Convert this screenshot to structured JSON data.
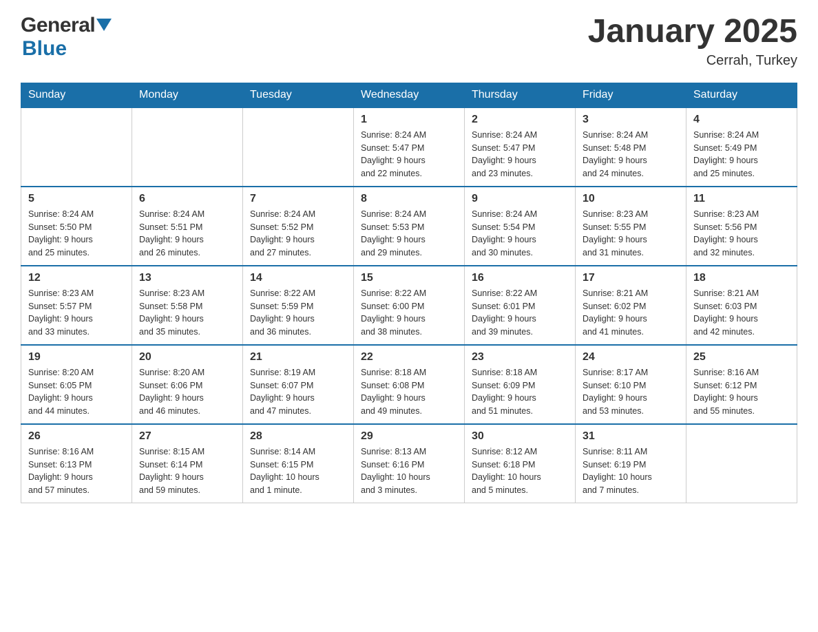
{
  "header": {
    "logo_general": "General",
    "logo_blue": "Blue",
    "title": "January 2025",
    "subtitle": "Cerrah, Turkey"
  },
  "days_of_week": [
    "Sunday",
    "Monday",
    "Tuesday",
    "Wednesday",
    "Thursday",
    "Friday",
    "Saturday"
  ],
  "weeks": [
    [
      {
        "day": "",
        "info": ""
      },
      {
        "day": "",
        "info": ""
      },
      {
        "day": "",
        "info": ""
      },
      {
        "day": "1",
        "info": "Sunrise: 8:24 AM\nSunset: 5:47 PM\nDaylight: 9 hours\nand 22 minutes."
      },
      {
        "day": "2",
        "info": "Sunrise: 8:24 AM\nSunset: 5:47 PM\nDaylight: 9 hours\nand 23 minutes."
      },
      {
        "day": "3",
        "info": "Sunrise: 8:24 AM\nSunset: 5:48 PM\nDaylight: 9 hours\nand 24 minutes."
      },
      {
        "day": "4",
        "info": "Sunrise: 8:24 AM\nSunset: 5:49 PM\nDaylight: 9 hours\nand 25 minutes."
      }
    ],
    [
      {
        "day": "5",
        "info": "Sunrise: 8:24 AM\nSunset: 5:50 PM\nDaylight: 9 hours\nand 25 minutes."
      },
      {
        "day": "6",
        "info": "Sunrise: 8:24 AM\nSunset: 5:51 PM\nDaylight: 9 hours\nand 26 minutes."
      },
      {
        "day": "7",
        "info": "Sunrise: 8:24 AM\nSunset: 5:52 PM\nDaylight: 9 hours\nand 27 minutes."
      },
      {
        "day": "8",
        "info": "Sunrise: 8:24 AM\nSunset: 5:53 PM\nDaylight: 9 hours\nand 29 minutes."
      },
      {
        "day": "9",
        "info": "Sunrise: 8:24 AM\nSunset: 5:54 PM\nDaylight: 9 hours\nand 30 minutes."
      },
      {
        "day": "10",
        "info": "Sunrise: 8:23 AM\nSunset: 5:55 PM\nDaylight: 9 hours\nand 31 minutes."
      },
      {
        "day": "11",
        "info": "Sunrise: 8:23 AM\nSunset: 5:56 PM\nDaylight: 9 hours\nand 32 minutes."
      }
    ],
    [
      {
        "day": "12",
        "info": "Sunrise: 8:23 AM\nSunset: 5:57 PM\nDaylight: 9 hours\nand 33 minutes."
      },
      {
        "day": "13",
        "info": "Sunrise: 8:23 AM\nSunset: 5:58 PM\nDaylight: 9 hours\nand 35 minutes."
      },
      {
        "day": "14",
        "info": "Sunrise: 8:22 AM\nSunset: 5:59 PM\nDaylight: 9 hours\nand 36 minutes."
      },
      {
        "day": "15",
        "info": "Sunrise: 8:22 AM\nSunset: 6:00 PM\nDaylight: 9 hours\nand 38 minutes."
      },
      {
        "day": "16",
        "info": "Sunrise: 8:22 AM\nSunset: 6:01 PM\nDaylight: 9 hours\nand 39 minutes."
      },
      {
        "day": "17",
        "info": "Sunrise: 8:21 AM\nSunset: 6:02 PM\nDaylight: 9 hours\nand 41 minutes."
      },
      {
        "day": "18",
        "info": "Sunrise: 8:21 AM\nSunset: 6:03 PM\nDaylight: 9 hours\nand 42 minutes."
      }
    ],
    [
      {
        "day": "19",
        "info": "Sunrise: 8:20 AM\nSunset: 6:05 PM\nDaylight: 9 hours\nand 44 minutes."
      },
      {
        "day": "20",
        "info": "Sunrise: 8:20 AM\nSunset: 6:06 PM\nDaylight: 9 hours\nand 46 minutes."
      },
      {
        "day": "21",
        "info": "Sunrise: 8:19 AM\nSunset: 6:07 PM\nDaylight: 9 hours\nand 47 minutes."
      },
      {
        "day": "22",
        "info": "Sunrise: 8:18 AM\nSunset: 6:08 PM\nDaylight: 9 hours\nand 49 minutes."
      },
      {
        "day": "23",
        "info": "Sunrise: 8:18 AM\nSunset: 6:09 PM\nDaylight: 9 hours\nand 51 minutes."
      },
      {
        "day": "24",
        "info": "Sunrise: 8:17 AM\nSunset: 6:10 PM\nDaylight: 9 hours\nand 53 minutes."
      },
      {
        "day": "25",
        "info": "Sunrise: 8:16 AM\nSunset: 6:12 PM\nDaylight: 9 hours\nand 55 minutes."
      }
    ],
    [
      {
        "day": "26",
        "info": "Sunrise: 8:16 AM\nSunset: 6:13 PM\nDaylight: 9 hours\nand 57 minutes."
      },
      {
        "day": "27",
        "info": "Sunrise: 8:15 AM\nSunset: 6:14 PM\nDaylight: 9 hours\nand 59 minutes."
      },
      {
        "day": "28",
        "info": "Sunrise: 8:14 AM\nSunset: 6:15 PM\nDaylight: 10 hours\nand 1 minute."
      },
      {
        "day": "29",
        "info": "Sunrise: 8:13 AM\nSunset: 6:16 PM\nDaylight: 10 hours\nand 3 minutes."
      },
      {
        "day": "30",
        "info": "Sunrise: 8:12 AM\nSunset: 6:18 PM\nDaylight: 10 hours\nand 5 minutes."
      },
      {
        "day": "31",
        "info": "Sunrise: 8:11 AM\nSunset: 6:19 PM\nDaylight: 10 hours\nand 7 minutes."
      },
      {
        "day": "",
        "info": ""
      }
    ]
  ]
}
